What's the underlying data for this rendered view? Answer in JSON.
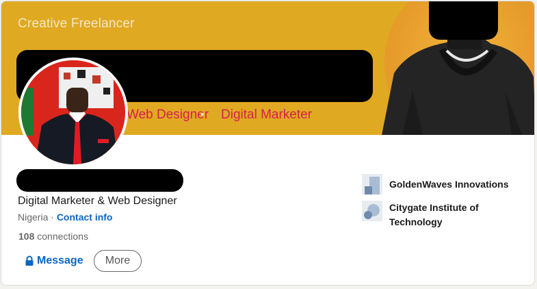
{
  "banner": {
    "tagline": "Creative Freelancer",
    "role_web": "Web Designer",
    "role_separator": "•",
    "role_marketer": "Digital Marketer",
    "accent_color": "#e0a922",
    "role_color": "#d6204d"
  },
  "profile": {
    "headline": "Digital Marketer & Web Designer",
    "location": "Nigeria",
    "location_separator": " · ",
    "contact_info_label": "Contact info",
    "connections_count": "108",
    "connections_label": " connections"
  },
  "actions": {
    "message_label": "Message",
    "message_icon": "lock-icon",
    "more_label": "More"
  },
  "organizations": [
    {
      "name": "GoldenWaves Innovations",
      "logo": "company-logo"
    },
    {
      "name": "Citygate Institute of Technology",
      "logo": "school-logo"
    }
  ],
  "link_color": "#0a66c2"
}
